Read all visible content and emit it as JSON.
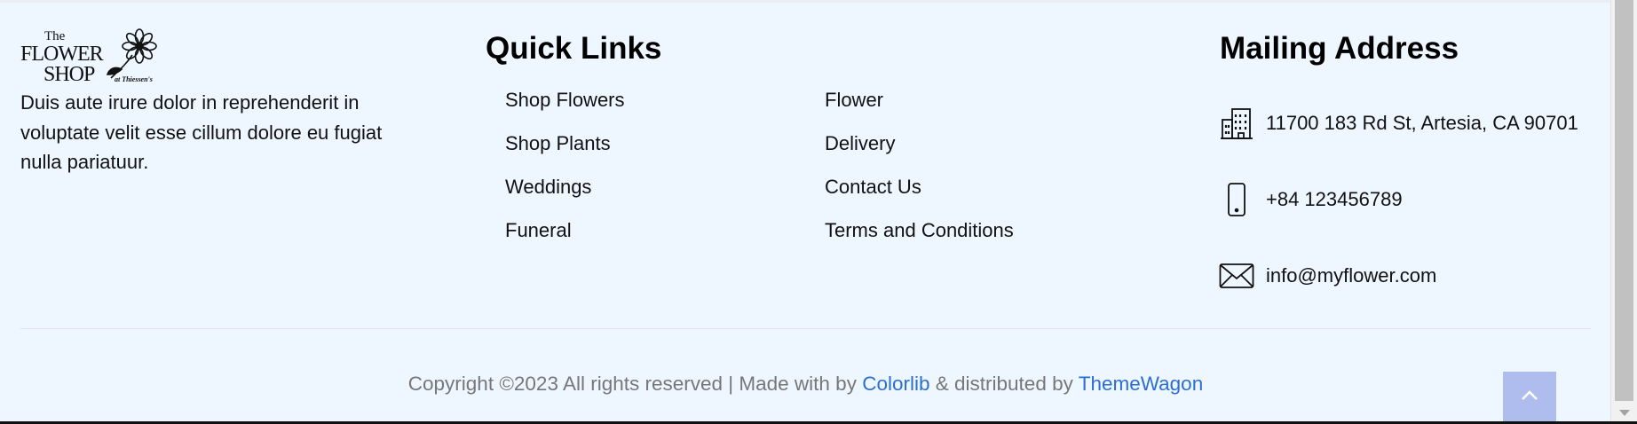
{
  "brand": {
    "logo_text_line1": "The",
    "logo_text_line2": "FLOWER",
    "logo_text_line3": "SHOP",
    "logo_text_line4": "at Thiessen's",
    "description": "Duis aute irure dolor in reprehenderit in voluptate velit esse cillum dolore eu fugiat nulla pariatuur."
  },
  "quick_links": {
    "title": "Quick Links",
    "column1": [
      "Shop Flowers",
      "Shop Plants",
      "Weddings",
      "Funeral"
    ],
    "column2": [
      "Flower",
      "Delivery",
      "Contact Us",
      "Terms and Conditions"
    ]
  },
  "mailing": {
    "title": "Mailing Address",
    "address": "11700 183 Rd St, Artesia, CA 90701",
    "phone": "+84 123456789",
    "email": "info@myflower.com",
    "address_icon": "building-icon",
    "phone_icon": "phone-icon",
    "email_icon": "envelope-icon"
  },
  "copyright": {
    "prefix": "Copyright ©2023 All rights reserved | Made with by",
    "link1": "Colorlib",
    "middle": "& distributed by",
    "link2": "ThemeWagon"
  },
  "colors": {
    "background": "#eef6ff",
    "link": "#2b6fd6",
    "back_to_top": "#aebdee"
  },
  "back_to_top_icon": "chevron-up-icon"
}
